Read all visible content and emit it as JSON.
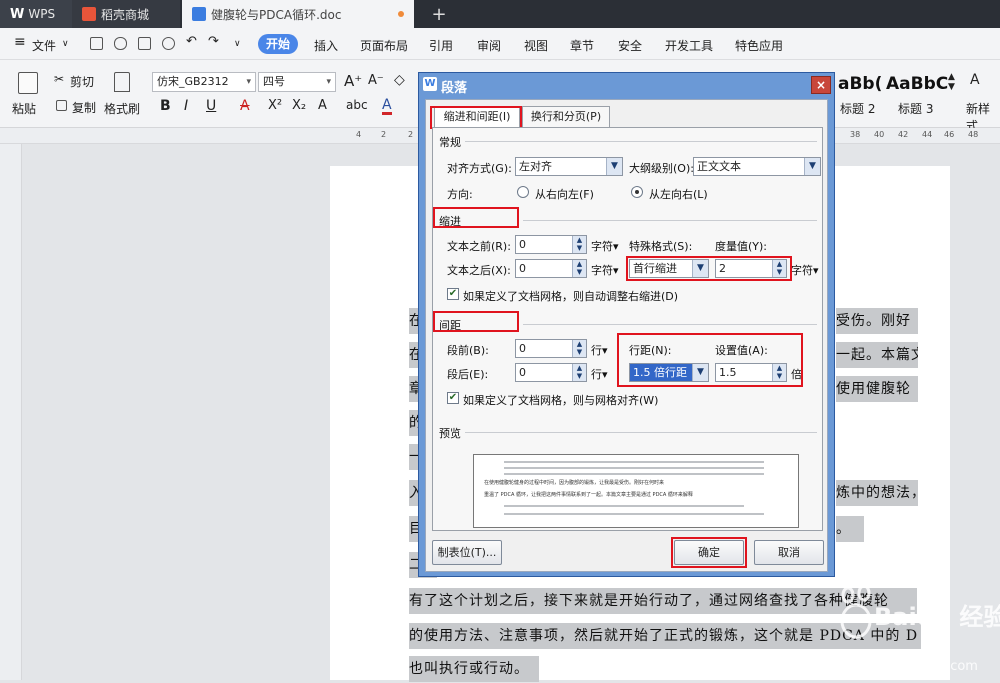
{
  "tabs": [
    {
      "label": "WPS"
    },
    {
      "label": "稻壳商城"
    },
    {
      "label": "健腹轮与PDCA循环.doc"
    }
  ],
  "menu": {
    "file": "文件",
    "items": [
      "开始",
      "插入",
      "页面布局",
      "引用",
      "审阅",
      "视图",
      "章节",
      "安全",
      "开发工具",
      "特色应用"
    ]
  },
  "ribbon": {
    "paste": "粘贴",
    "cut": "剪切",
    "copy": "复制",
    "format_painter": "格式刷",
    "font": "仿宋_GB2312",
    "size": "四号",
    "styles": [
      {
        "sample": "aBb(",
        "label": "标题 2"
      },
      {
        "sample": "AaBbC",
        "label": "标题 3"
      }
    ],
    "new_style": "新样式"
  },
  "ruler": [
    "4",
    "2",
    "2",
    "4",
    "38",
    "40",
    "42",
    "44",
    "46",
    "48"
  ],
  "document": {
    "lines": [
      {
        "left": "在",
        "right": "受伤。刚好"
      },
      {
        "left": "在",
        "right": "一起。本篇文"
      },
      {
        "left": "章",
        "right": "使用健腹轮"
      },
      {
        "left": "的",
        "right": ""
      },
      {
        "left": "一",
        "right": ""
      },
      {
        "left": "入",
        "right": "炼中的想法，"
      },
      {
        "left": "目",
        "right": "。"
      },
      {
        "left": "二",
        "right": ""
      }
    ],
    "full_lines": [
      "有了这个计划之后，接下来就是开始行动了，通过网络查找了各种健腹轮",
      "的使用方法、注意事项，然后就开始了正式的锻炼，这个就是 PDCA 中的 D",
      "也叫执行或行动。"
    ]
  },
  "dialog": {
    "title": "段落",
    "close": "×",
    "tabs": [
      "缩进和间距(I)",
      "换行和分页(P)"
    ],
    "general": {
      "heading": "常规",
      "align_label": "对齐方式(G):",
      "align_value": "左对齐",
      "outline_label": "大纲级别(O):",
      "outline_value": "正文文本",
      "direction_label": "方向:",
      "rtl": "从右向左(F)",
      "ltr": "从左向右(L)"
    },
    "indent": {
      "heading": "缩进",
      "before_label": "文本之前(R):",
      "before_value": "0",
      "after_label": "文本之后(X):",
      "after_value": "0",
      "unit": "字符▾",
      "special_label": "特殊格式(S):",
      "special_value": "首行缩进",
      "measure_label": "度量值(Y):",
      "measure_value": "2",
      "grid_check": "如果定义了文档网格，则自动调整右缩进(D)"
    },
    "spacing": {
      "heading": "间距",
      "before_label": "段前(B):",
      "before_value": "0",
      "after_label": "段后(E):",
      "after_value": "0",
      "unit": "行▾",
      "line_label": "行距(N):",
      "line_value": "1.5 倍行距",
      "set_label": "设置值(A):",
      "set_value": "1.5",
      "set_unit": "倍",
      "grid_check": "如果定义了文档网格，则与网格对齐(W)"
    },
    "preview": {
      "heading": "预览",
      "lines": [
        "在使用健腹轮健身的过程中时间，因为腹部的锻炼，让我最是受伤。刚好在何时来",
        "重温了 PDCA 循环，让我把这两件事情联系到了一起。本篇文章主要是通过 PDCA 循环来解释"
      ]
    },
    "tabstop": "制表位(T)...",
    "ok": "确定",
    "cancel": "取消"
  },
  "watermark": {
    "text1": "Baidu 经验",
    "text2": "jingyan.baidu.com"
  }
}
